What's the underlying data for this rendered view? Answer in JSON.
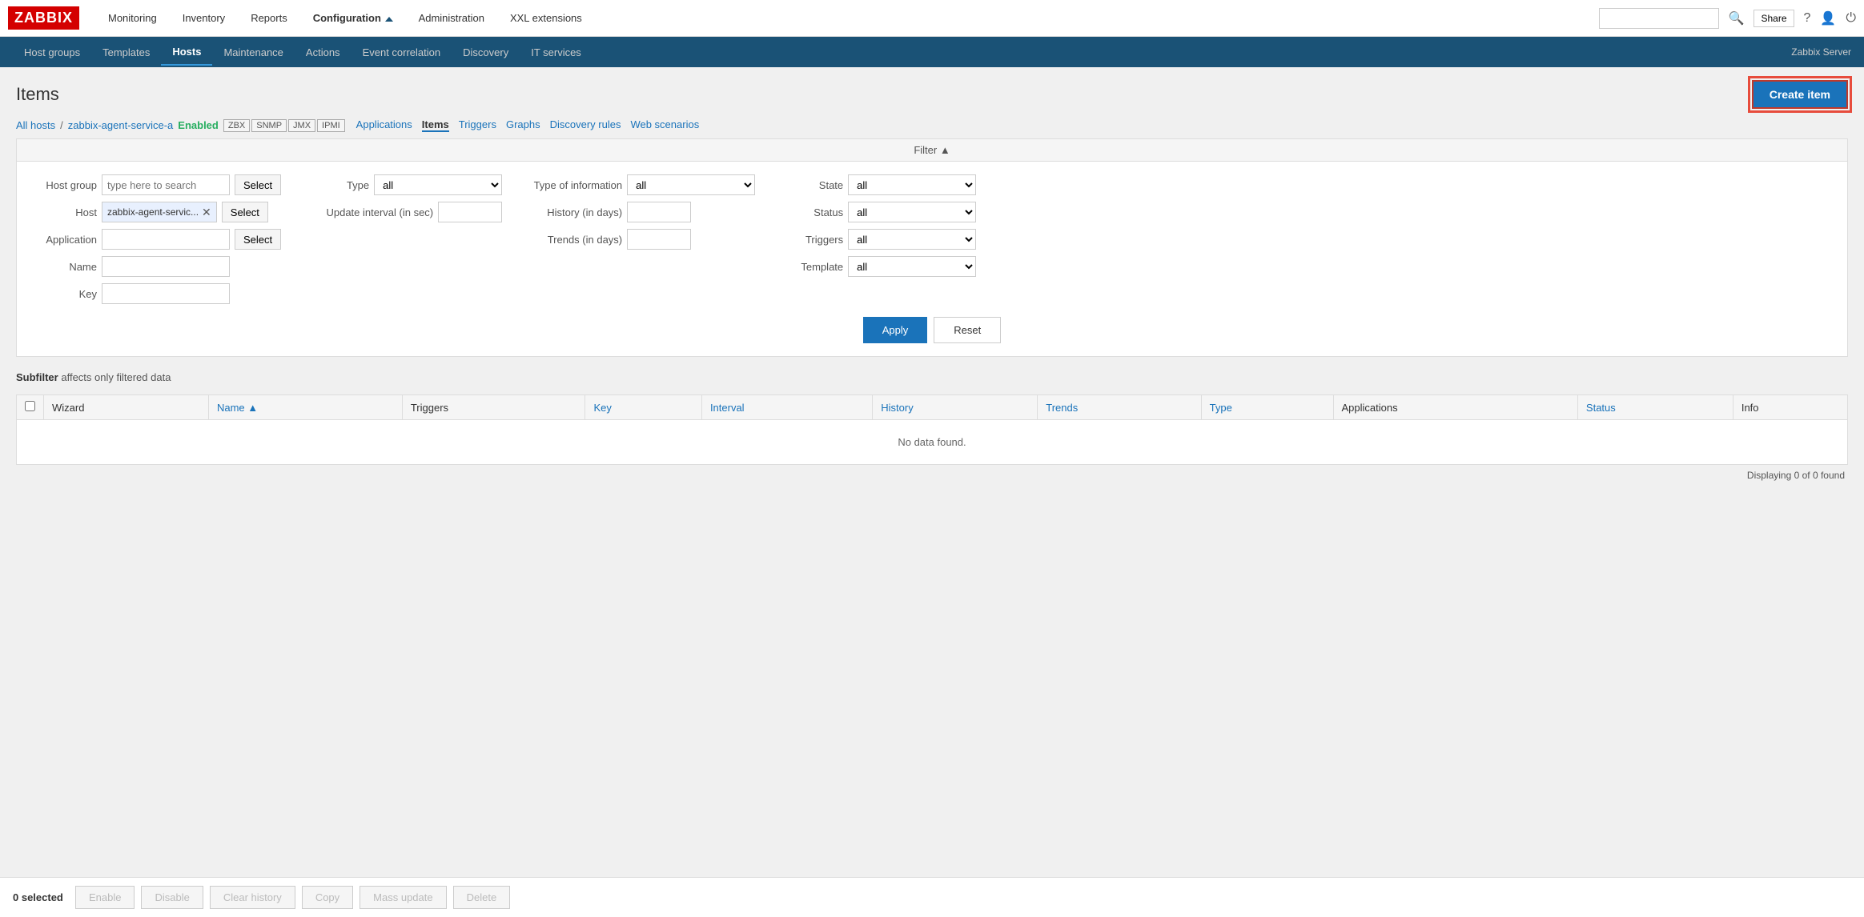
{
  "logo": {
    "text": "ZABBIX"
  },
  "topNav": {
    "items": [
      {
        "label": "Monitoring",
        "active": false
      },
      {
        "label": "Inventory",
        "active": false
      },
      {
        "label": "Reports",
        "active": false
      },
      {
        "label": "Configuration",
        "active": true
      },
      {
        "label": "Administration",
        "active": false
      },
      {
        "label": "XXL extensions",
        "active": false
      }
    ],
    "searchPlaceholder": "",
    "shareLabel": "Share",
    "helpLabel": "?"
  },
  "subNav": {
    "items": [
      {
        "label": "Host groups",
        "active": false
      },
      {
        "label": "Templates",
        "active": false
      },
      {
        "label": "Hosts",
        "active": true
      },
      {
        "label": "Maintenance",
        "active": false
      },
      {
        "label": "Actions",
        "active": false
      },
      {
        "label": "Event correlation",
        "active": false
      },
      {
        "label": "Discovery",
        "active": false
      },
      {
        "label": "IT services",
        "active": false
      }
    ],
    "serverLabel": "Zabbix Server"
  },
  "page": {
    "title": "Items",
    "createButton": "Create item"
  },
  "breadcrumb": {
    "allHosts": "All hosts",
    "separator": "/",
    "hostName": "zabbix-agent-service-a",
    "status": "Enabled",
    "protocols": [
      "ZBX",
      "SNMP",
      "JMX",
      "IPMI"
    ],
    "links": [
      {
        "label": "Applications",
        "active": false
      },
      {
        "label": "Items",
        "active": true
      },
      {
        "label": "Triggers",
        "active": false
      },
      {
        "label": "Graphs",
        "active": false
      },
      {
        "label": "Discovery rules",
        "active": false
      },
      {
        "label": "Web scenarios",
        "active": false
      }
    ]
  },
  "filter": {
    "headerLabel": "Filter ▲",
    "fields": {
      "hostGroup": {
        "label": "Host group",
        "placeholder": "type here to search",
        "selectBtn": "Select"
      },
      "host": {
        "label": "Host",
        "tagValue": "zabbix-agent-servic...",
        "selectBtn": "Select"
      },
      "application": {
        "label": "Application",
        "selectBtn": "Select"
      },
      "name": {
        "label": "Name"
      },
      "key": {
        "label": "Key"
      },
      "type": {
        "label": "Type",
        "value": "all",
        "options": [
          "all"
        ]
      },
      "updateInterval": {
        "label": "Update interval (in sec)"
      },
      "typeOfInfo": {
        "label": "Type of information",
        "value": "all",
        "options": [
          "all"
        ]
      },
      "historyDays": {
        "label": "History (in days)"
      },
      "trendsDays": {
        "label": "Trends (in days)"
      },
      "state": {
        "label": "State",
        "value": "all",
        "options": [
          "all"
        ]
      },
      "status": {
        "label": "Status",
        "value": "all",
        "options": [
          "all"
        ]
      },
      "triggers": {
        "label": "Triggers",
        "value": "all",
        "options": [
          "all"
        ]
      },
      "template": {
        "label": "Template",
        "value": "all",
        "options": [
          "all"
        ]
      }
    },
    "applyBtn": "Apply",
    "resetBtn": "Reset"
  },
  "subfilter": {
    "label": "Subfilter",
    "description": "affects only filtered data"
  },
  "table": {
    "columns": [
      {
        "label": "Wizard"
      },
      {
        "label": "Name ▲",
        "sortable": true
      },
      {
        "label": "Triggers"
      },
      {
        "label": "Key"
      },
      {
        "label": "Interval"
      },
      {
        "label": "History"
      },
      {
        "label": "Trends"
      },
      {
        "label": "Type"
      },
      {
        "label": "Applications"
      },
      {
        "label": "Status"
      },
      {
        "label": "Info"
      }
    ],
    "noData": "No data found.",
    "displayCount": "Displaying 0 of 0 found"
  },
  "bottomBar": {
    "selectedCount": "0 selected",
    "buttons": [
      {
        "label": "Enable",
        "disabled": true
      },
      {
        "label": "Disable",
        "disabled": true
      },
      {
        "label": "Clear history",
        "disabled": true
      },
      {
        "label": "Copy",
        "disabled": true
      },
      {
        "label": "Mass update",
        "disabled": true
      },
      {
        "label": "Delete",
        "disabled": true
      }
    ]
  }
}
